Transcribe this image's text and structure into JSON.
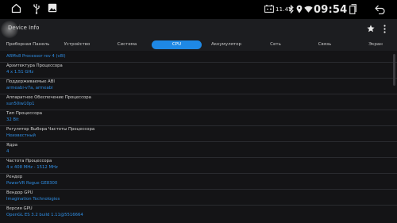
{
  "status_bar": {
    "voltage": "11.4V",
    "time": "09:54",
    "icons": [
      "home-icon",
      "usb-icon",
      "gallery-icon",
      "battery-icon",
      "bluetooth-icon",
      "location-icon",
      "wifi-icon",
      "recent-apps-icon",
      "back-icon"
    ]
  },
  "app_bar": {
    "title": "Device Info",
    "icons": [
      "star-icon",
      "more-vert-icon"
    ]
  },
  "tabs": [
    {
      "label": "Приборная Панель"
    },
    {
      "label": "Устройство"
    },
    {
      "label": "Система"
    },
    {
      "label": "CPU",
      "active": true
    },
    {
      "label": "Аккумулятор"
    },
    {
      "label": "Сеть"
    },
    {
      "label": "Связь"
    },
    {
      "label": "Экран"
    }
  ],
  "colors": {
    "accent": "#1e88e5",
    "value_text": "#2f8fe6",
    "background": "#141416"
  },
  "rows": [
    {
      "label": "",
      "value": "ARMv8 Processor rev 4 (v8l)"
    },
    {
      "label": "Архитектура Процессора",
      "value": "4 x 1.51 GHz"
    },
    {
      "label": "Поддерживаемые ABI",
      "value": "armeabi-v7a, armeabi"
    },
    {
      "label": "Аппаратное Обеспечение Процессора",
      "value": "sun50iw10p1"
    },
    {
      "label": "Тип Процессора",
      "value": "32 Bit"
    },
    {
      "label": "Регулятор Выбора Частоты Процессора",
      "value": "Неизвестный"
    },
    {
      "label": "Ядра",
      "value": "4"
    },
    {
      "label": "Частота Процессора",
      "value": "4 x 408 MHz - 1512 MHz"
    },
    {
      "label": "Рендер",
      "value": "PowerVR Rogue GE8300"
    },
    {
      "label": "Вендор GPU",
      "value": "Imagination Technologies"
    },
    {
      "label": "Версия GPU",
      "value": "OpenGL ES 3.2 build 1.11@5516664"
    }
  ]
}
